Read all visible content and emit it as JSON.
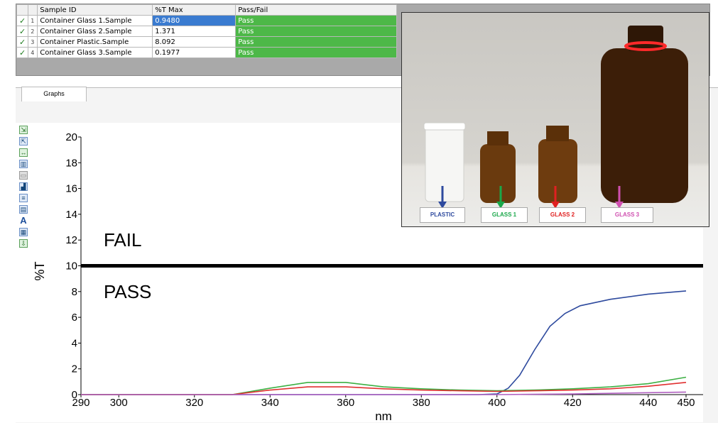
{
  "table": {
    "headers": [
      "Sample ID",
      "%T Max",
      "Pass/Fail"
    ],
    "rows": [
      {
        "index": "1",
        "sample_id": "Container Glass 1.Sample",
        "t_max": "0.9480",
        "result": "Pass"
      },
      {
        "index": "2",
        "sample_id": "Container Glass 2.Sample",
        "t_max": "1.371",
        "result": "Pass"
      },
      {
        "index": "3",
        "sample_id": "Container Plastic.Sample",
        "t_max": "8.092",
        "result": "Pass"
      },
      {
        "index": "4",
        "sample_id": "Container Glass 3.Sample",
        "t_max": "0.1977",
        "result": "Pass"
      }
    ],
    "check_icon": "check-mark-icon",
    "pass_color": "#4db848",
    "selected_color": "#3a7bd0"
  },
  "tabs": [
    "Graphs"
  ],
  "toolbar": {
    "icons": [
      "zoom-in-icon",
      "zoom-out-icon",
      "fit-icon",
      "overlay-icon",
      "comment-icon",
      "peak-icon",
      "text-icon",
      "layout-icon",
      "font-icon",
      "grid-icon",
      "export-icon"
    ]
  },
  "photo": {
    "labels": [
      {
        "text": "PLASTIC",
        "color": "#2e4a9e"
      },
      {
        "text": "GLASS 1",
        "color": "#1aa84a"
      },
      {
        "text": "GLASS 2",
        "color": "#e02020"
      },
      {
        "text": "GLASS 3",
        "color": "#d050b0"
      }
    ]
  },
  "chart_data": {
    "type": "line",
    "xlabel": "nm",
    "ylabel": "%T",
    "xlim": [
      290,
      450
    ],
    "ylim": [
      0,
      20
    ],
    "xticks": [
      290,
      300,
      320,
      340,
      360,
      380,
      400,
      420,
      440,
      450
    ],
    "yticks": [
      0,
      2,
      4,
      6,
      8,
      10,
      12,
      14,
      16,
      18,
      20
    ],
    "annotations": [
      {
        "text": "FAIL",
        "x": 296,
        "y": 12
      },
      {
        "text": "PASS",
        "x": 296,
        "y": 8
      }
    ],
    "threshold": {
      "y": 10,
      "color": "#000000"
    },
    "series": [
      {
        "color": "#2e4a9e",
        "x": [
          290,
          395,
          400,
          403,
          406,
          410,
          414,
          418,
          422,
          430,
          440,
          450
        ],
        "y": [
          0,
          0,
          0.05,
          0.5,
          1.5,
          3.5,
          5.3,
          6.3,
          6.9,
          7.4,
          7.8,
          8.05
        ]
      },
      {
        "color": "#3cb043",
        "x": [
          290,
          330,
          340,
          350,
          360,
          370,
          380,
          390,
          400,
          410,
          420,
          430,
          440,
          450
        ],
        "y": [
          0,
          0,
          0.5,
          0.95,
          0.95,
          0.6,
          0.45,
          0.35,
          0.3,
          0.35,
          0.45,
          0.6,
          0.85,
          1.35
        ]
      },
      {
        "color": "#e03030",
        "x": [
          290,
          330,
          340,
          350,
          360,
          370,
          380,
          390,
          400,
          410,
          420,
          430,
          440,
          450
        ],
        "y": [
          0,
          0,
          0.35,
          0.6,
          0.6,
          0.45,
          0.35,
          0.3,
          0.25,
          0.3,
          0.35,
          0.45,
          0.65,
          0.95
        ]
      },
      {
        "color": "#b060c0",
        "x": [
          290,
          400,
          420,
          440,
          450
        ],
        "y": [
          0,
          0,
          0.05,
          0.15,
          0.2
        ]
      }
    ]
  }
}
